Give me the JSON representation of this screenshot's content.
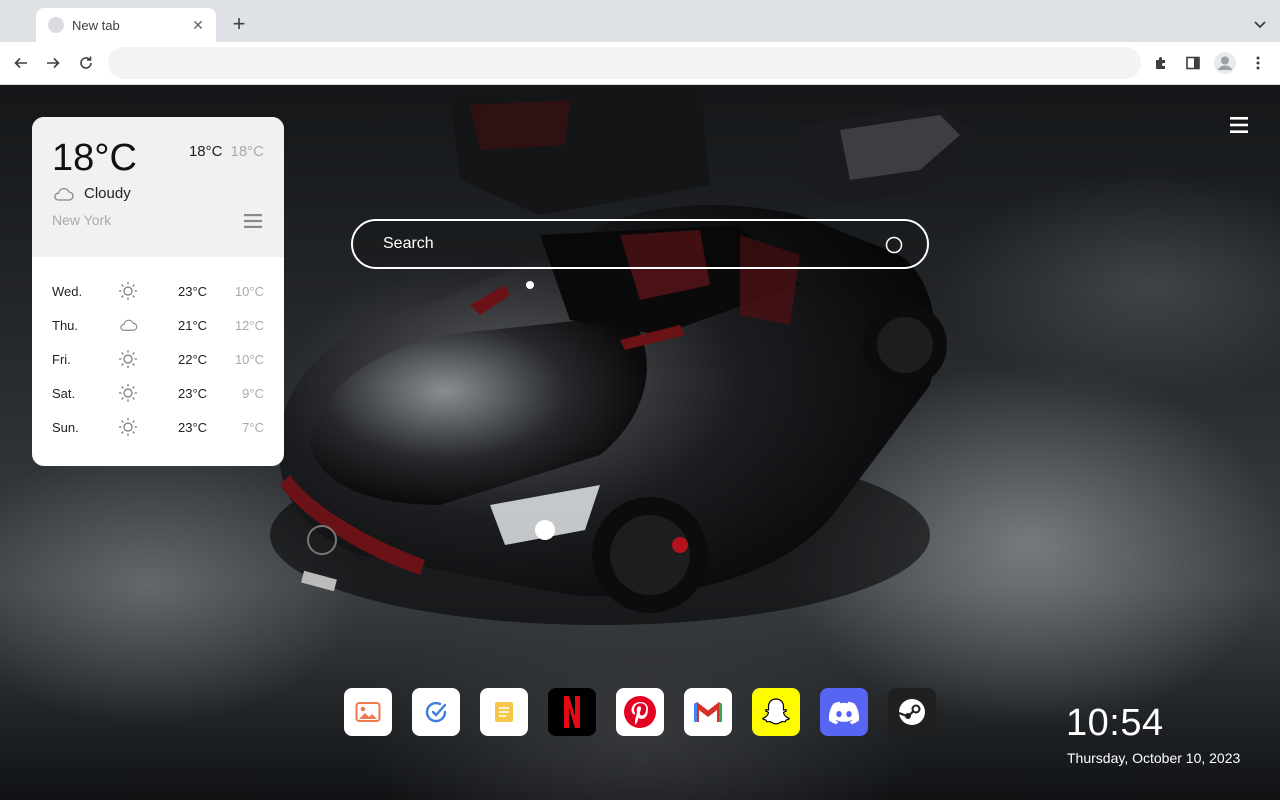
{
  "browser": {
    "tab_title": "New tab",
    "address_value": "",
    "address_placeholder": ""
  },
  "search": {
    "placeholder": "Search"
  },
  "weather": {
    "current_temp": "18°C",
    "high": "18°C",
    "low": "18°C",
    "condition": "Cloudy",
    "city": "New York",
    "forecast": [
      {
        "day": "Wed.",
        "icon": "sun-icon",
        "high": "23°C",
        "low": "10°C"
      },
      {
        "day": "Thu.",
        "icon": "cloud-icon",
        "high": "21°C",
        "low": "12°C"
      },
      {
        "day": "Fri.",
        "icon": "sun-icon",
        "high": "22°C",
        "low": "10°C"
      },
      {
        "day": "Sat.",
        "icon": "sun-icon",
        "high": "23°C",
        "low": "9°C"
      },
      {
        "day": "Sun.",
        "icon": "sun-icon",
        "high": "23°C",
        "low": "7°C"
      }
    ]
  },
  "dock": [
    {
      "name": "gallery",
      "bg": "#ffffff"
    },
    {
      "name": "tasks",
      "bg": "#ffffff"
    },
    {
      "name": "notes",
      "bg": "#ffffff"
    },
    {
      "name": "netflix",
      "bg": "#000000"
    },
    {
      "name": "pinterest",
      "bg": "#ffffff"
    },
    {
      "name": "gmail",
      "bg": "#ffffff"
    },
    {
      "name": "snapchat",
      "bg": "#fffc00"
    },
    {
      "name": "discord",
      "bg": "#5865f2"
    },
    {
      "name": "steam",
      "bg": "#1f1f1f"
    }
  ],
  "clock": {
    "time": "10:54",
    "date": "Thursday, October 10, 2023"
  }
}
